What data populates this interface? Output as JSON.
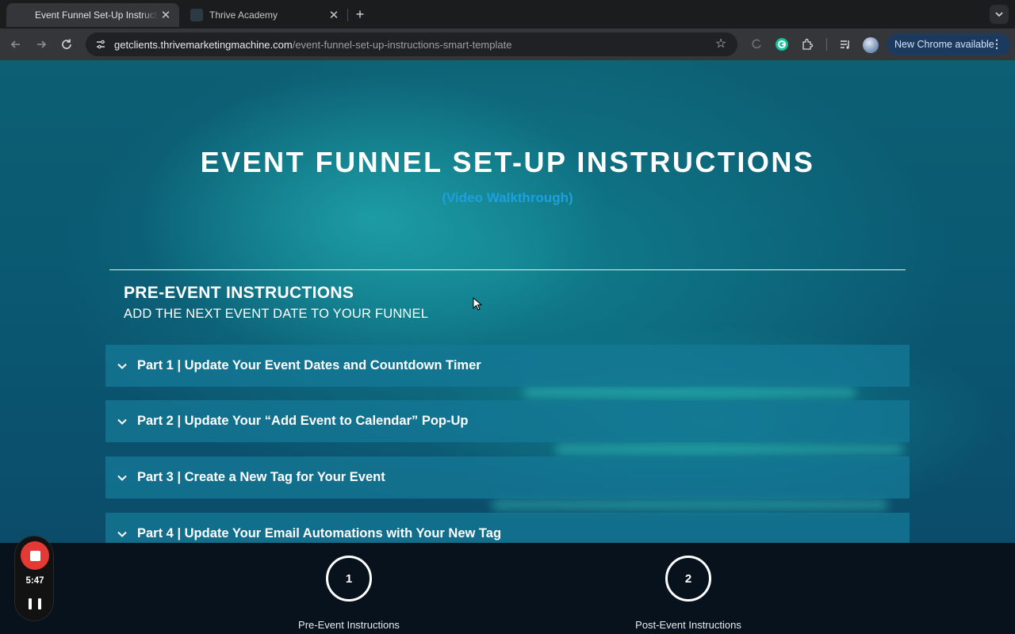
{
  "browser": {
    "tabs": [
      {
        "title": "Event Funnel Set-Up Instructions | Thrive",
        "active": true
      },
      {
        "title": "Thrive Academy",
        "active": false
      }
    ],
    "new_tab_symbol": "+",
    "url_host": "getclients.thrivemarketingmachine.com",
    "url_path": "/event-funnel-set-up-instructions-smart-template",
    "update_chip_label": "New Chrome available",
    "icons": [
      "back-icon",
      "forward-icon",
      "reload-icon",
      "site-info-icon",
      "bookmark-star-icon",
      "loading-extension-icon",
      "grammarly-icon",
      "extensions-icon",
      "media-queue-icon",
      "profile-avatar",
      "menu-dots-icon",
      "tab-search-icon"
    ]
  },
  "page": {
    "title": "EVENT FUNNEL SET-UP INSTRUCTIONS",
    "subtitle": "(Video Walkthrough)",
    "section_title": "PRE-EVENT INSTRUCTIONS",
    "section_subtitle": "ADD THE NEXT EVENT DATE TO YOUR FUNNEL",
    "accordion": [
      {
        "label": "Part 1 | Update Your Event Dates and Countdown Timer"
      },
      {
        "label": "Part 2 | Update Your “Add Event to Calendar” Pop-Up"
      },
      {
        "label": "Part 3 | Create a New Tag for Your Event"
      },
      {
        "label": "Part 4 | Update Your Email Automations with Your New Tag"
      }
    ],
    "colors": {
      "subtitle": "#1e9fe0",
      "accordion_bg": "#1478961",
      "hero_bg": "#0d5f73"
    }
  },
  "steps": [
    {
      "number": "1",
      "caption": "Pre-Event Instructions"
    },
    {
      "number": "2",
      "caption": "Post-Event Instructions"
    }
  ],
  "recorder": {
    "time": "5:47",
    "colors": {
      "stop": "#e53935"
    }
  }
}
